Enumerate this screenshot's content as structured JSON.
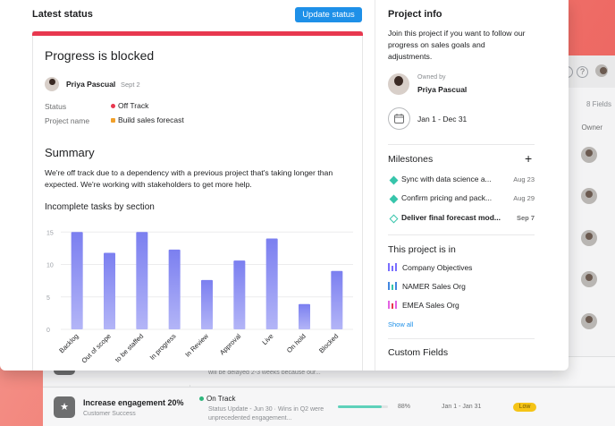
{
  "background_app": {
    "fields_label": "8 Fields",
    "owner_header": "Owner",
    "help_icon": "?",
    "rows": [
      {
        "name": "",
        "team": "Product",
        "status": "",
        "update": "will be delayed 2-3 weeks because our..."
      },
      {
        "name": "Increase engagement 20%",
        "team": "Customer Success",
        "status": "On Track",
        "update_line1": "Status Update - Jun 30 · Wins in Q2 were",
        "update_line2": "unprecedented engagement...",
        "progress": "88%",
        "progress_value": 88,
        "dates": "Jan 1 - Jan 31",
        "priority": "Low"
      }
    ]
  },
  "latest_status": {
    "title": "Latest status",
    "update_button": "Update status",
    "headline": "Progress is blocked",
    "author": "Priya Pascual",
    "date": "Sept 2",
    "fields": [
      {
        "label": "Status",
        "value": "Off Track",
        "color": "#e8384f"
      },
      {
        "label": "Project name",
        "value": "Build sales forecast",
        "color": "#f1a02b"
      }
    ],
    "summary_title": "Summary",
    "summary_text": "We're off track due to a dependency with a previous project that's taking longer than expected. We're working with stakeholders to get more help.",
    "chart_title": "Incomplete tasks by section"
  },
  "chart_data": {
    "type": "bar",
    "title": "Incomplete tasks by section",
    "categories": [
      "Backlog",
      "Out of scope",
      "to be staffed",
      "In progress",
      "In Review",
      "Approval",
      "Live",
      "On hold",
      "Blocked"
    ],
    "values": [
      15,
      11.8,
      15,
      12.3,
      7.6,
      10.6,
      14,
      3.9,
      9
    ],
    "yticks": [
      0,
      5,
      10,
      15
    ],
    "ylim": [
      0,
      16
    ],
    "grid": true,
    "bar_color": "#7b7ff0"
  },
  "project_info": {
    "title": "Project info",
    "description": "Join this project if you want to follow our progress on sales goals and adjustments.",
    "owned_by_label": "Owned by",
    "owner": "Priya Pascual",
    "date_range": "Jan 1 - Dec 31",
    "milestones_title": "Milestones",
    "milestones": [
      {
        "name": "Sync with data science a...",
        "date": "Aug 23",
        "done": true
      },
      {
        "name": "Confirm pricing and pack...",
        "date": "Aug 29",
        "done": true
      },
      {
        "name": "Deliver final forecast mod...",
        "date": "Sep 7",
        "done": false
      }
    ],
    "portfolios_title": "This project is in",
    "portfolios": [
      {
        "name": "Company Objectives",
        "color": "#796eff"
      },
      {
        "name": "NAMER Sales Org",
        "color": "#4186e0"
      },
      {
        "name": "EMEA Sales Org",
        "color": "#e362e3"
      }
    ],
    "show_all": "Show all",
    "custom_fields_title": "Custom Fields"
  }
}
